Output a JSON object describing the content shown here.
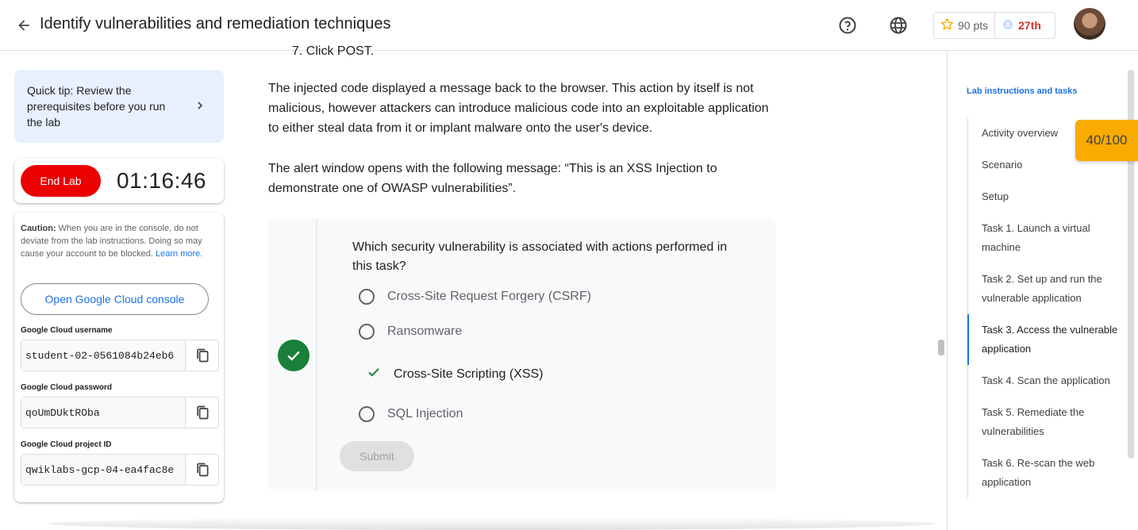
{
  "header": {
    "title": "Identify vulnerabilities and remediation techniques",
    "points": "90 pts",
    "rank": "27th"
  },
  "tip": {
    "text": "Quick tip: Review the prerequisites before you run the lab"
  },
  "lab": {
    "end_label": "End Lab",
    "timer": "01:16:46"
  },
  "credentials": {
    "caution_bold": "Caution:",
    "caution_text": " When you are in the console, do not deviate from the lab instructions. Doing so may cause your account to be blocked. ",
    "learn_more": "Learn more.",
    "console_button": "Open Google Cloud console",
    "username_label": "Google Cloud username",
    "username_value": "student-02-0561084b24eb6",
    "password_label": "Google Cloud password",
    "password_value": "qoUmDUktROba",
    "project_label": "Google Cloud project ID",
    "project_value": "qwiklabs-gcp-04-ea4fac8e"
  },
  "content": {
    "partial_line": "7. Click POST.",
    "para1": "The injected code displayed a message back to the browser. This action by itself is not malicious, however attackers can introduce malicious code into an exploitable application to either steal data from it or implant malware onto the user's device.",
    "para2": "The alert window opens with the following message: “This is an XSS Injection to demonstrate one of OWASP vulnerabilities”."
  },
  "quiz": {
    "question": "Which security vulnerability is associated with actions performed in this task?",
    "options": [
      "Cross-Site Request Forgery (CSRF)",
      "Ransomware",
      "Cross-Site Scripting (XSS)",
      "SQL Injection"
    ],
    "selected_index": 2,
    "submit_label": "Submit"
  },
  "toc": {
    "title": "Lab instructions and tasks",
    "items": [
      "Activity overview",
      "Scenario",
      "Setup",
      "Task 1. Launch a virtual machine",
      "Task 2. Set up and run the vulnerable application",
      "Task 3. Access the vulnerable application",
      "Task 4. Scan the application",
      "Task 5. Remediate the vulnerabilities",
      "Task 6. Re-scan the web application"
    ],
    "active_index": 5
  },
  "score": "40/100",
  "colors": {
    "accent": "#1a73e8",
    "end_lab": "#ea0000",
    "success": "#188038",
    "score_badge": "#f9ab00"
  }
}
